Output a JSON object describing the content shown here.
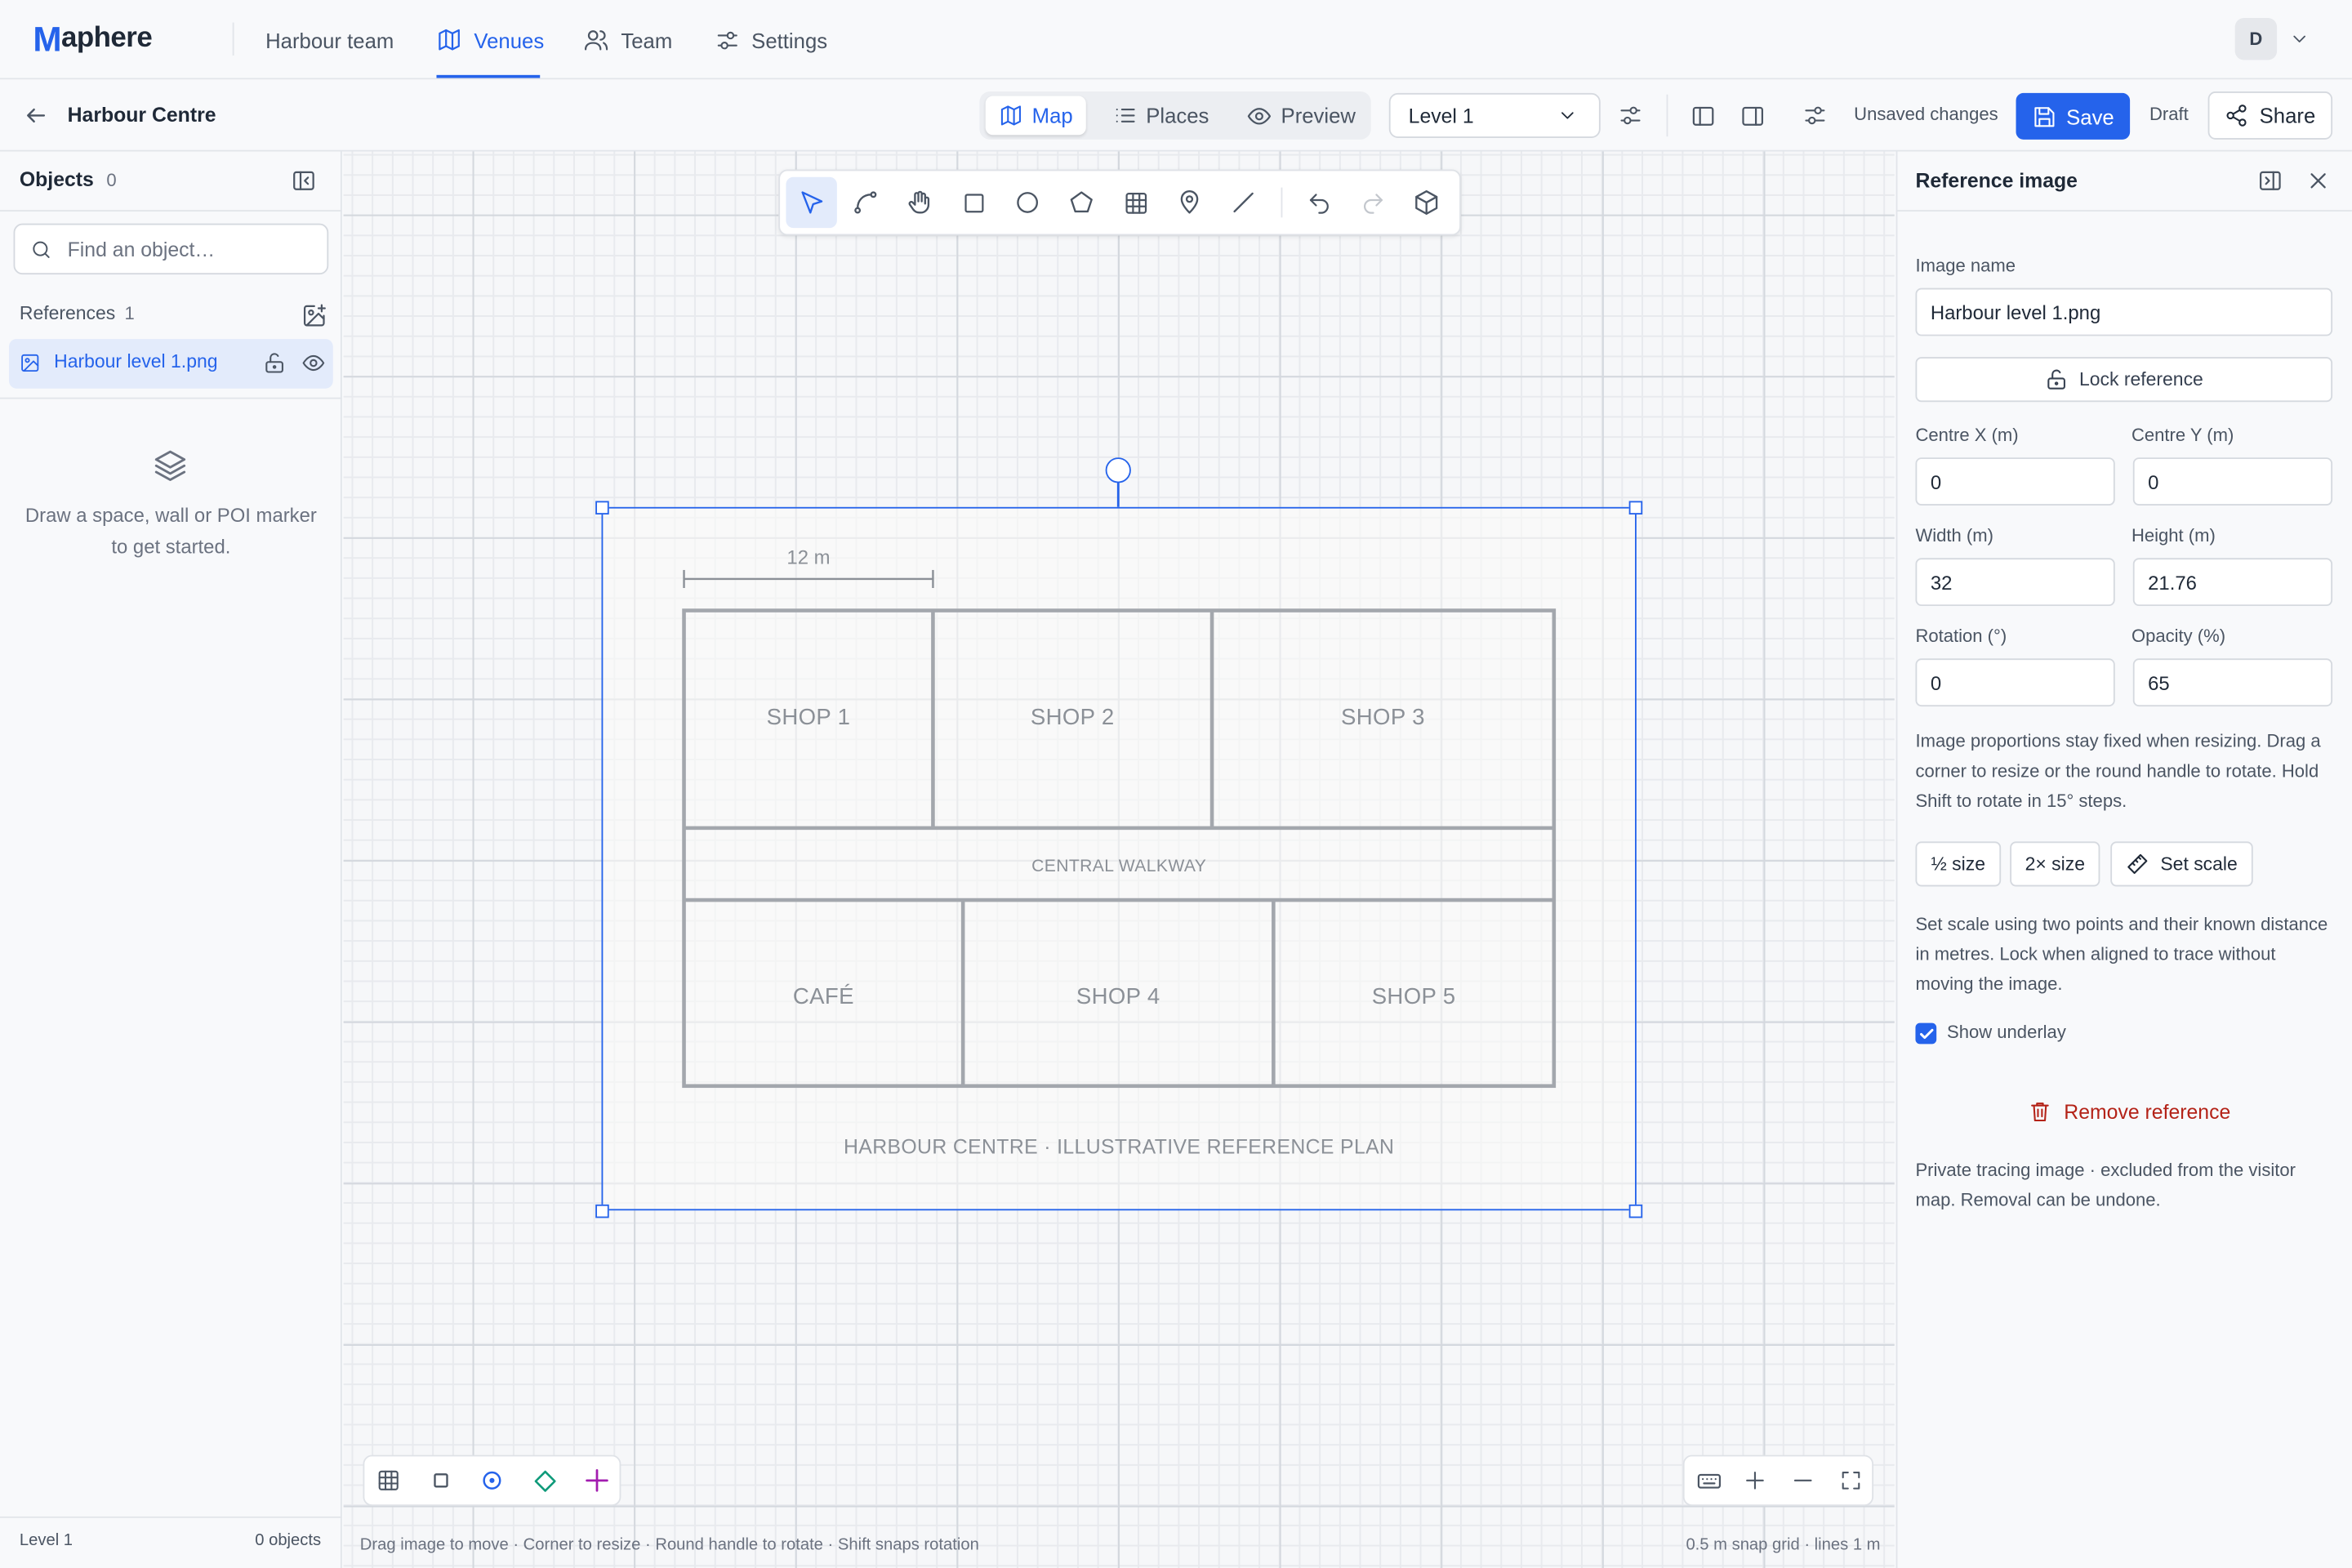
{
  "app": {
    "logo_mark": "M",
    "logo_rest": "aphere"
  },
  "nav": {
    "items": [
      {
        "label": "Harbour team",
        "icon": "none"
      },
      {
        "label": "Venues",
        "icon": "map-icon"
      },
      {
        "label": "Team",
        "icon": "users-icon"
      },
      {
        "label": "Settings",
        "icon": "sliders-icon"
      }
    ],
    "active": "Venues"
  },
  "user": {
    "initial": "D"
  },
  "toolbar": {
    "venue_title": "Harbour Centre",
    "modes": [
      "Map",
      "Places",
      "Preview"
    ],
    "active_mode": "Map",
    "level_select": "Level 1",
    "unsaved": "Unsaved changes",
    "save_label": "Save",
    "draft_label": "Draft",
    "share_label": "Share"
  },
  "left_panel": {
    "title": "Objects",
    "count": "0",
    "search_placeholder": "Find an object…",
    "references_label": "References",
    "references_count": "1",
    "reference_name": "Harbour level 1.png",
    "empty_text": "Draw a space, wall or POI marker to get started.",
    "footer_level": "Level 1",
    "footer_count": "0 objects"
  },
  "canvas": {
    "scale_label": "12 m",
    "rooms": [
      "SHOP 1",
      "SHOP 2",
      "SHOP 3",
      "CENTRAL WALKWAY",
      "CAFÉ",
      "SHOP 4",
      "SHOP 5"
    ],
    "plan_caption": "HARBOUR CENTRE · ILLUSTRATIVE REFERENCE PLAN",
    "hint": "Drag image to move · Corner to resize · Round handle to rotate · Shift snaps rotation",
    "grid_info": "0.5 m snap grid · lines 1 m"
  },
  "right_panel": {
    "title": "Reference image",
    "image_name_label": "Image name",
    "image_name": "Harbour level 1.png",
    "lock_label": "Lock reference",
    "centre_x_label": "Centre X (m)",
    "centre_x": "0",
    "centre_y_label": "Centre Y (m)",
    "centre_y": "0",
    "width_label": "Width (m)",
    "width": "32",
    "height_label": "Height (m)",
    "height": "21.76",
    "rotation_label": "Rotation (°)",
    "rotation": "0",
    "opacity_label": "Opacity (%)",
    "opacity": "65",
    "resize_help": "Image proportions stay fixed when resizing. Drag a corner to resize or the round handle to rotate. Hold Shift to rotate in 15° steps.",
    "half_size": "½ size",
    "double_size": "2× size",
    "set_scale": "Set scale",
    "scale_help": "Set scale using two points and their known distance in metres. Lock when aligned to trace without moving the image.",
    "show_underlay_label": "Show underlay",
    "show_underlay": true,
    "remove_label": "Remove reference",
    "private_note": "Private tracing image · excluded from the visitor map. Removal can be undone."
  },
  "colors": {
    "accent": "#2563eb",
    "danger": "#b42318",
    "canvas_bg": "#f6f7f9"
  }
}
